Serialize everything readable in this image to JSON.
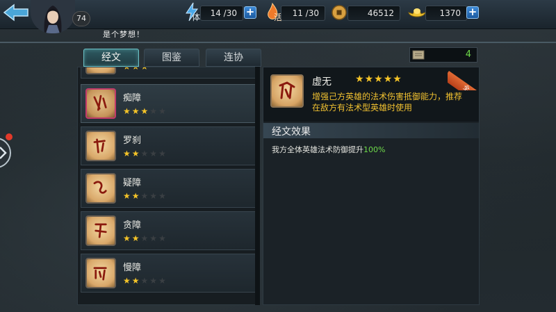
{
  "topbar": {
    "level": "74",
    "stamina": {
      "icon": "lightning-icon",
      "label": "体",
      "value": "14 /30"
    },
    "vitality": {
      "icon": "flame-icon",
      "label": "活",
      "value": "11 /30"
    },
    "coins": {
      "icon": "copper-coin-icon",
      "value": "46512"
    },
    "ingots": {
      "icon": "gold-ingot-icon",
      "value": "1370"
    },
    "marquee": "是个梦想！"
  },
  "tabs": [
    {
      "label": "经文",
      "active": true
    },
    {
      "label": "图鉴",
      "active": false
    },
    {
      "label": "连协",
      "active": false
    }
  ],
  "scroll_count": "4",
  "list": {
    "items": [
      {
        "name": "痴障",
        "stars": 3,
        "max_stars": 5
      },
      {
        "name": "罗刹",
        "stars": 2,
        "max_stars": 5
      },
      {
        "name": "疑障",
        "stars": 2,
        "max_stars": 5
      },
      {
        "name": "贪障",
        "stars": 2,
        "max_stars": 5
      },
      {
        "name": "慢障",
        "stars": 2,
        "max_stars": 5
      }
    ]
  },
  "detail": {
    "name": "虚无",
    "stars": 5,
    "corner_badge": "全",
    "description": "增强己方英雄的法术伤害抵御能力，推荐在敌方有法术型英雄时使用",
    "effect_title": "经文效果",
    "effect_text": "我方全体英雄法术防御提升",
    "effect_value": "100%"
  },
  "colors": {
    "star_on": "#f5c428",
    "desc_gold": "#f0c030",
    "effect_green": "#6fdc4a",
    "tab_active": "#6cc3c8"
  }
}
